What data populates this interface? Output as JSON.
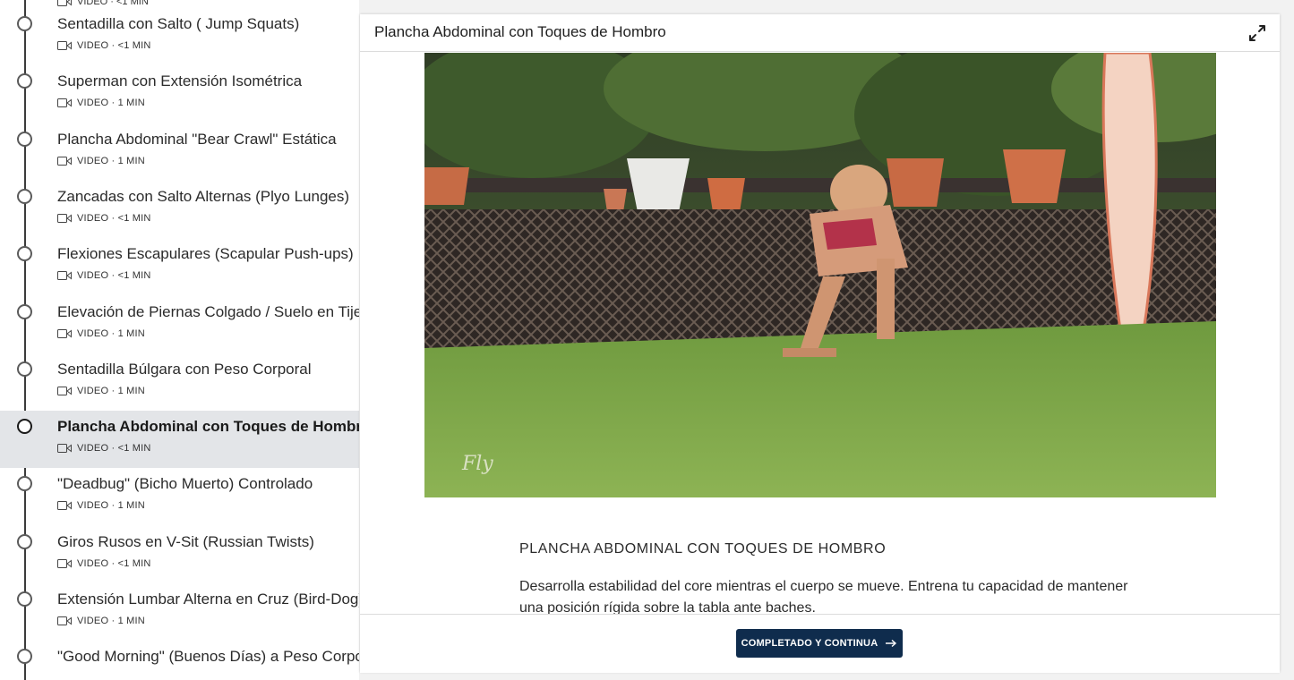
{
  "sidebar": {
    "partial_meta": "VIDEO · <1 MIN",
    "lessons": [
      {
        "title": "Sentadilla con Salto ( Jump Squats)",
        "meta": "VIDEO · <1 MIN"
      },
      {
        "title": "Superman con Extensión Isométrica",
        "meta": "VIDEO · 1 MIN"
      },
      {
        "title": "Plancha Abdominal \"Bear Crawl\" Estática",
        "meta": "VIDEO · 1 MIN"
      },
      {
        "title": "Zancadas con Salto Alternas (Plyo Lunges)",
        "meta": "VIDEO · <1 MIN"
      },
      {
        "title": "Flexiones Escapulares (Scapular Push-ups)",
        "meta": "VIDEO · <1 MIN"
      },
      {
        "title": "Elevación de Piernas Colgado / Suelo en Tijera",
        "meta": "VIDEO · 1 MIN"
      },
      {
        "title": "Sentadilla Búlgara con Peso Corporal",
        "meta": "VIDEO · 1 MIN"
      },
      {
        "title": "Plancha Abdominal con Toques de Hombro",
        "meta": "VIDEO · <1 MIN",
        "active": true
      },
      {
        "title": "\"Deadbug\" (Bicho Muerto) Controlado",
        "meta": "VIDEO · 1 MIN"
      },
      {
        "title": "Giros Rusos en V-Sit (Russian Twists)",
        "meta": "VIDEO · <1 MIN"
      },
      {
        "title": "Extensión Lumbar Alterna en Cruz (Bird-Dog)",
        "meta": "VIDEO · 1 MIN"
      },
      {
        "title": "\"Good Morning\" (Buenos Días) a Peso Corporal",
        "meta": ""
      }
    ]
  },
  "panel": {
    "title": "Plancha Abdominal con Toques de Hombro",
    "expand_icon": "expand-icon",
    "video_watermark": "Fly",
    "heading": "PLANCHA ABDOMINAL CON TOQUES DE HOMBRO",
    "description": "Desarrolla estabilidad del core mientras el cuerpo se mueve. Entrena tu capacidad de mantener una posición rígida sobre la tabla ante baches.",
    "complete_button": "COMPLETADO Y CONTINUA"
  },
  "colors": {
    "primary_button": "#0f2c4d",
    "active_lesson_bg": "#e3e5e8",
    "timeline": "#3b3b3b"
  }
}
